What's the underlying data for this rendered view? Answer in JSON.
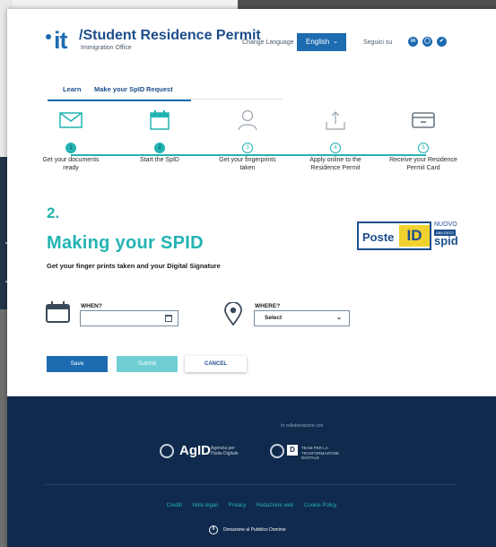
{
  "header": {
    "logo": "it",
    "title": "/Student Residence Permit",
    "subtitle": "Immigration Office",
    "change_language_label": "Change Language",
    "language_selected": "English",
    "follow_label": "Seguici su",
    "social": [
      "linkedin-icon",
      "github-icon",
      "twitter-icon"
    ]
  },
  "tabs": [
    {
      "label": "Learn"
    },
    {
      "label": "Make your SpID"
    },
    {
      "label": "Request"
    }
  ],
  "steps": [
    {
      "num": "1",
      "label_line1": "Get your documents",
      "label_line2": "ready",
      "active": true,
      "icon": "envelope-icon"
    },
    {
      "num": "2",
      "label_line1": "Start the SpID",
      "label_line2": "",
      "active": true,
      "icon": "calendar-icon"
    },
    {
      "num": "3",
      "label_line1": "Get your fingerprints",
      "label_line2": "taken",
      "active": false,
      "icon": "user-icon"
    },
    {
      "num": "4",
      "label_line1": "Apply online to the",
      "label_line2": "Residence Permit",
      "active": false,
      "icon": "upload-icon"
    },
    {
      "num": "5",
      "label_line1": "Receive your Residence",
      "label_line2": "Permit Card",
      "active": false,
      "icon": "card-icon"
    }
  ],
  "section": {
    "number": "2.",
    "title": "Making your SPID",
    "subtitle": "Get your finger prints taken and your Digital Signature"
  },
  "poste": {
    "word": "Poste",
    "id": "ID",
    "nuovo": "NUOVO",
    "abilitato": "ABILITATO",
    "spid": "spid"
  },
  "form": {
    "when_label": "WHEN?",
    "when_value": "",
    "where_label": "WHERE?",
    "where_value": "Select"
  },
  "buttons": {
    "save": "Save",
    "submit": "Submit",
    "cancel": "CANCEL"
  },
  "footer": {
    "collab": "In collaborazione con",
    "agid_word": "AgID",
    "agid_sub": "Agenzia per l'Italia Digitale",
    "td_letter": "D",
    "td_sub": "TEAM PER LA TRASFORMAZIONE DIGITALE",
    "links": [
      "Crediti",
      "Note legali",
      "Privacy",
      "Redazione web",
      "Cookie Policy"
    ],
    "public_domain": "Donazione al Pubblico Dominio"
  },
  "colors": {
    "primary": "#1d6bb0",
    "teal": "#23b3b3",
    "footer": "#0f2a4c"
  }
}
